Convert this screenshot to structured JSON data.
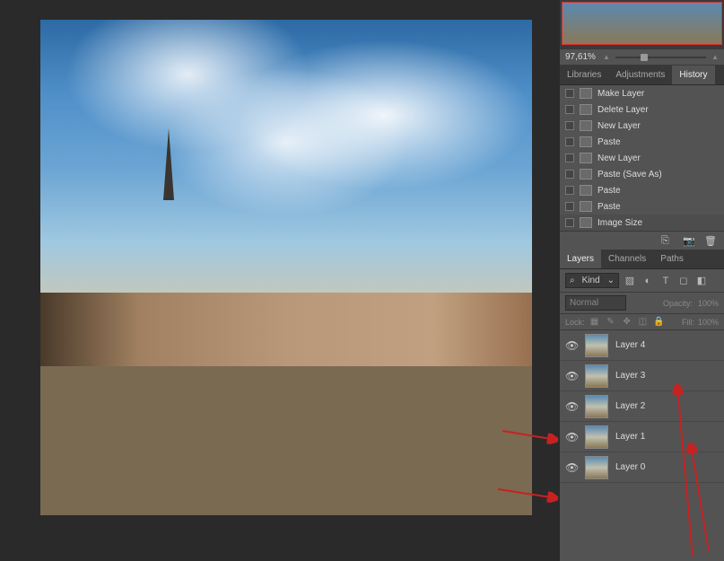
{
  "navigator": {
    "zoom": "97,61%"
  },
  "panel_tabs": {
    "libraries": "Libraries",
    "adjustments": "Adjustments",
    "history": "History"
  },
  "history": [
    {
      "label": "Make Layer"
    },
    {
      "label": "Delete Layer"
    },
    {
      "label": "New Layer"
    },
    {
      "label": "Paste"
    },
    {
      "label": "New Layer"
    },
    {
      "label": "Paste (Save As)"
    },
    {
      "label": "Paste"
    },
    {
      "label": "Paste"
    },
    {
      "label": "Image Size"
    }
  ],
  "layer_tabs": {
    "layers": "Layers",
    "channels": "Channels",
    "paths": "Paths"
  },
  "layer_filter": {
    "kind": "Kind"
  },
  "blend": {
    "mode": "Normal",
    "opacity_label": "Opacity:",
    "opacity_value": "100%"
  },
  "lock": {
    "label": "Lock:",
    "fill_label": "Fill:",
    "fill_value": "100%"
  },
  "layers": [
    {
      "name": "Layer 4"
    },
    {
      "name": "Layer 3"
    },
    {
      "name": "Layer 2"
    },
    {
      "name": "Layer 1"
    },
    {
      "name": "Layer 0"
    }
  ],
  "icons": {
    "search": "⌕",
    "chev": "⌄",
    "eye": "👁"
  }
}
